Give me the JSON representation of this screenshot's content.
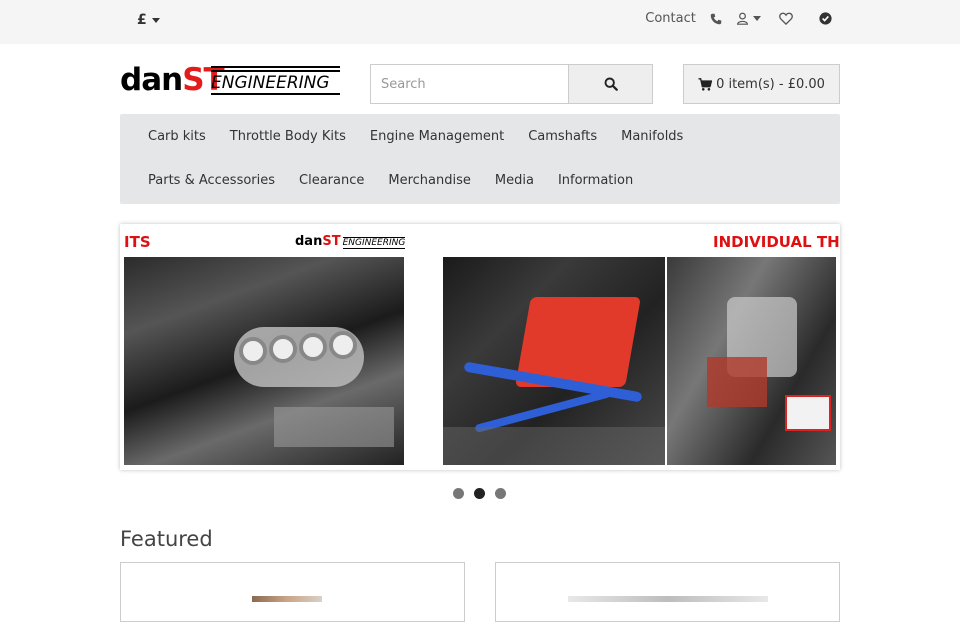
{
  "topbar": {
    "currency": "£",
    "contact_label": "Contact",
    "icons": [
      "phone-icon",
      "user-icon",
      "heart-icon",
      "check-circle-icon"
    ]
  },
  "brand": {
    "logo_dan": "dan",
    "logo_st": "ST",
    "logo_engineering": "ENGINEERING"
  },
  "search": {
    "placeholder": "Search",
    "button_icon": "search-icon"
  },
  "cart": {
    "label": "0 item(s) - £0.00",
    "icon": "cart-icon"
  },
  "nav": {
    "row1": [
      "Carb kits",
      "Throttle Body Kits",
      "Engine Management",
      "Camshafts",
      "Manifolds"
    ],
    "row2": [
      "Parts & Accessories",
      "Clearance",
      "Merchandise",
      "Media",
      "Information"
    ]
  },
  "banner": {
    "left_label": "ITS",
    "right_label": "INDIVIDUAL THRO",
    "slides": 3,
    "active_slide": 2
  },
  "featured": {
    "heading": "Featured"
  },
  "colors": {
    "brand_red": "#e31b1b",
    "nav_bg": "#e4e6e8",
    "topbar_bg": "#f5f5f5"
  }
}
